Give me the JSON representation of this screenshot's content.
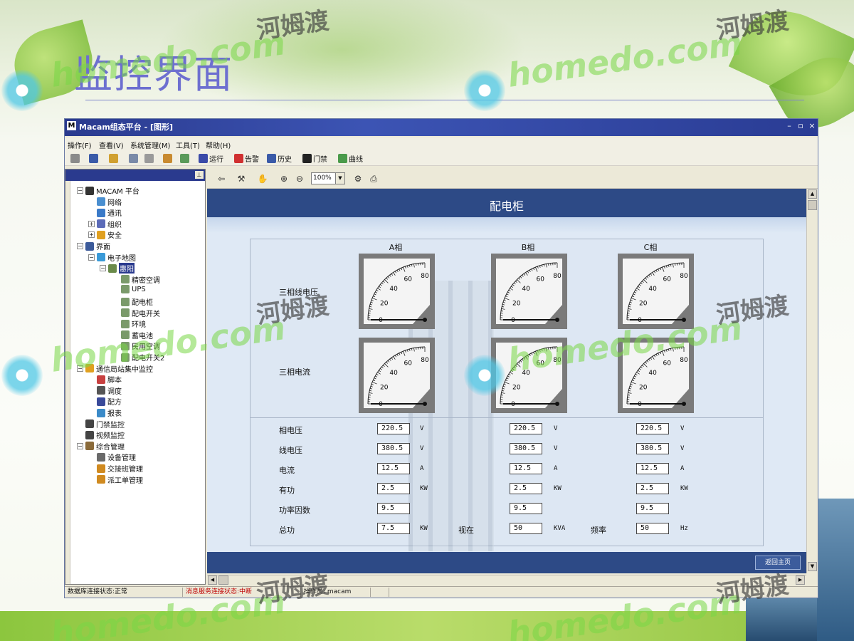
{
  "slide": {
    "title": "监控界面"
  },
  "window": {
    "title": "Macam组态平台 - [图形]",
    "app_icon": "M",
    "controls": [
      "–",
      "▫",
      "×"
    ]
  },
  "menu": [
    "操作(F)",
    "查看(V)",
    "系统管理(M)",
    "工具(T)",
    "帮助(H)"
  ],
  "toolbar": {
    "run": "运行",
    "alarm": "告警",
    "history": "历史",
    "door": "门禁",
    "curve": "曲线"
  },
  "tree": [
    {
      "label": "MACAM 平台",
      "level": 0,
      "toggle": "⊟",
      "icon": "macam-icon",
      "color": "#333"
    },
    {
      "label": "网络",
      "level": 1,
      "icon": "network-icon",
      "color": "#4a8fd0"
    },
    {
      "label": "通讯",
      "level": 1,
      "icon": "comm-icon",
      "color": "#3a7ac8"
    },
    {
      "label": "组织",
      "level": 1,
      "toggle": "⊞",
      "icon": "org-icon",
      "color": "#5b6bb8"
    },
    {
      "label": "安全",
      "level": 1,
      "toggle": "⊞",
      "icon": "lock-icon",
      "color": "#e0a020"
    },
    {
      "label": "界面",
      "level": 0,
      "toggle": "⊟",
      "icon": "monitor-icon",
      "color": "#3b5a9a"
    },
    {
      "label": "电子地图",
      "level": 1,
      "toggle": "⊟",
      "icon": "globe-icon",
      "color": "#3a9ad8"
    },
    {
      "label": "惠阳",
      "level": 2,
      "toggle": "⊟",
      "icon": "site-icon",
      "color": "#6a8a4a",
      "selected": true
    },
    {
      "label": "精密空调",
      "level": 3,
      "icon": "device-icon",
      "color": "#7a9a6a"
    },
    {
      "label": "UPS",
      "level": 3,
      "icon": "device-icon",
      "color": "#7a9a6a"
    },
    {
      "label": "配电柜",
      "level": 3,
      "icon": "device-icon",
      "color": "#7a9a6a"
    },
    {
      "label": "配电开关",
      "level": 3,
      "icon": "device-icon",
      "color": "#7a9a6a"
    },
    {
      "label": "环境",
      "level": 3,
      "icon": "device-icon",
      "color": "#7a9a6a"
    },
    {
      "label": "蓄电池",
      "level": 3,
      "icon": "device-icon",
      "color": "#7a9a6a"
    },
    {
      "label": "民用空调",
      "level": 3,
      "icon": "device-icon",
      "color": "#7a9a6a"
    },
    {
      "label": "配电开关2",
      "level": 3,
      "icon": "device-icon",
      "color": "#7a9a6a"
    },
    {
      "label": "通信局站集中监控",
      "level": 0,
      "toggle": "⊟",
      "icon": "station-icon",
      "color": "#e0a020"
    },
    {
      "label": "脚本",
      "level": 1,
      "icon": "script-icon",
      "color": "#c84040"
    },
    {
      "label": "调度",
      "level": 1,
      "icon": "schedule-icon",
      "color": "#555"
    },
    {
      "label": "配方",
      "level": 1,
      "icon": "recipe-icon",
      "color": "#3a4a9a"
    },
    {
      "label": "报表",
      "level": 1,
      "icon": "report-icon",
      "color": "#3a8ac8"
    },
    {
      "label": "门禁监控",
      "level": 0,
      "icon": "door-icon",
      "color": "#444"
    },
    {
      "label": "视频监控",
      "level": 0,
      "icon": "video-icon",
      "color": "#444"
    },
    {
      "label": "综合管理",
      "level": 0,
      "toggle": "⊟",
      "icon": "manage-icon",
      "color": "#8a6a3a"
    },
    {
      "label": "设备管理",
      "level": 1,
      "icon": "equipment-icon",
      "color": "#6a6a6a"
    },
    {
      "label": "交接班管理",
      "level": 1,
      "icon": "shift-icon",
      "color": "#d08a20"
    },
    {
      "label": "派工单管理",
      "level": 1,
      "icon": "dispatch-icon",
      "color": "#d08a20"
    }
  ],
  "view": {
    "zoom": "100%",
    "title": "配电柜",
    "phases": [
      "A相",
      "B相",
      "C相"
    ],
    "gauge_rows": [
      "三相线电压",
      "三相电流"
    ],
    "gauge_ticks": [
      "0",
      "20",
      "40",
      "60",
      "80"
    ],
    "gauge_value": 0,
    "measurements": [
      {
        "label": "相电压",
        "values": [
          "220.5",
          "220.5",
          "220.5"
        ],
        "unit": "V"
      },
      {
        "label": "线电压",
        "values": [
          "380.5",
          "380.5",
          "380.5"
        ],
        "unit": "V"
      },
      {
        "label": "电流",
        "values": [
          "12.5",
          "12.5",
          "12.5"
        ],
        "unit": "A"
      },
      {
        "label": "有功",
        "values": [
          "2.5",
          "2.5",
          "2.5"
        ],
        "unit": "KW"
      },
      {
        "label": "功率因数",
        "values": [
          "9.5",
          "9.5",
          "9.5"
        ],
        "unit": ""
      },
      {
        "label": "总功",
        "values": [
          "7.5",
          "50",
          "50"
        ],
        "units": [
          "KW",
          "KVA",
          "Hz"
        ],
        "extra_labels": [
          "视在",
          "频率"
        ]
      }
    ],
    "back_button": "返回主页"
  },
  "status": {
    "db": "数据库连接状态:正常",
    "msg": "消息服务连接状态:中断",
    "operator": "操作员: macam"
  },
  "watermark": {
    "latin": "homedo.com",
    "cn": "河姆渡"
  }
}
